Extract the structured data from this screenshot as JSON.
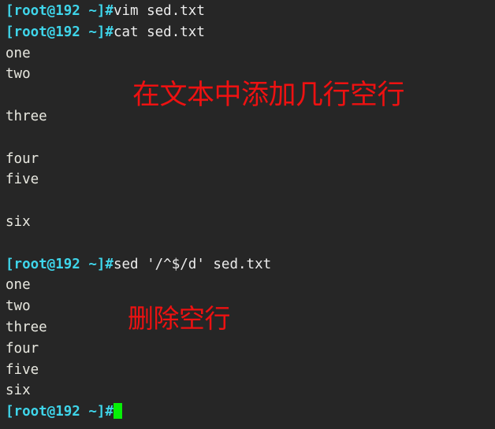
{
  "terminal": {
    "background_color": "#262626",
    "prompt_color": "#3fd5ea",
    "output_color": "#e8e8e0",
    "cursor_color": "#07ef07",
    "annotation_color": "#ee1111",
    "prompt_text": "[root@192 ~]#"
  },
  "lines": [
    {
      "type": "command",
      "prompt": "[root@192 ~]#",
      "command": "vim sed.txt"
    },
    {
      "type": "command",
      "prompt": "[root@192 ~]#",
      "command": "cat sed.txt"
    },
    {
      "type": "output",
      "text": "one"
    },
    {
      "type": "output",
      "text": "two"
    },
    {
      "type": "blank",
      "text": ""
    },
    {
      "type": "output",
      "text": "three"
    },
    {
      "type": "blank",
      "text": ""
    },
    {
      "type": "output",
      "text": "four"
    },
    {
      "type": "output",
      "text": "five"
    },
    {
      "type": "blank",
      "text": ""
    },
    {
      "type": "output",
      "text": "six"
    },
    {
      "type": "blank",
      "text": ""
    },
    {
      "type": "command",
      "prompt": "[root@192 ~]#",
      "command": "sed '/^$/d' sed.txt"
    },
    {
      "type": "output",
      "text": "one"
    },
    {
      "type": "output",
      "text": "two"
    },
    {
      "type": "output",
      "text": "three"
    },
    {
      "type": "output",
      "text": "four"
    },
    {
      "type": "output",
      "text": "five"
    },
    {
      "type": "output",
      "text": "six"
    },
    {
      "type": "cursor-prompt",
      "prompt": "[root@192 ~]#",
      "command": ""
    }
  ],
  "annotations": {
    "add_blank_lines": "在文本中添加几行空行",
    "delete_blank_lines": "删除空行"
  }
}
